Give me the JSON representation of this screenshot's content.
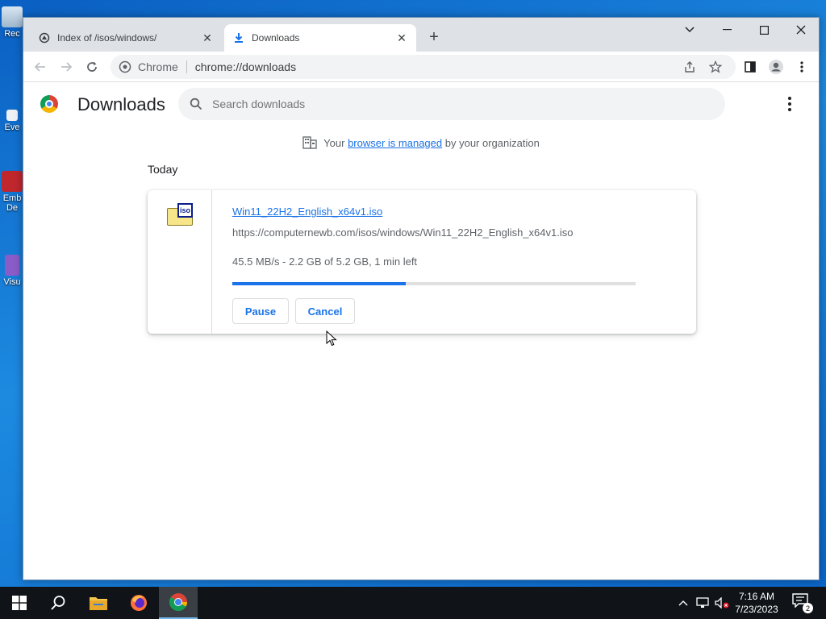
{
  "desktop": {
    "icons": [
      {
        "label": "Rec",
        "name": "recycle-bin"
      },
      {
        "label": "Eve",
        "name": "event-viewer"
      },
      {
        "label": "Emb",
        "name": "embarcadero"
      },
      {
        "label": "De",
        "name": "embarcadero-2"
      },
      {
        "label": "Visu",
        "name": "visual-studio"
      }
    ]
  },
  "browser": {
    "tabs": [
      {
        "title": "Index of /isos/windows/",
        "icon": "page-icon",
        "active": false
      },
      {
        "title": "Downloads",
        "icon": "download-icon",
        "active": true
      }
    ],
    "omnibox": {
      "site_label": "Chrome",
      "url": "chrome://downloads"
    }
  },
  "downloads": {
    "title": "Downloads",
    "search_placeholder": "Search downloads",
    "managed_prefix": "Your",
    "managed_link": "browser is managed",
    "managed_suffix": "by your organization",
    "section_label": "Today",
    "items": [
      {
        "file_name": "Win11_22H2_English_x64v1.iso",
        "url": "https://computernewb.com/isos/windows/Win11_22H2_English_x64v1.iso",
        "status": "45.5 MB/s - 2.2 GB of 5.2 GB, 1 min left",
        "file_badge": "iso",
        "progress_fraction": 0.43,
        "pause_label": "Pause",
        "cancel_label": "Cancel"
      }
    ]
  },
  "taskbar": {
    "time": "7:16 AM",
    "date": "7/23/2023",
    "notification_count": "2"
  },
  "colors": {
    "accent": "#1a73e8",
    "taskbar": "#101418",
    "desktop": "#1d8ae0"
  }
}
